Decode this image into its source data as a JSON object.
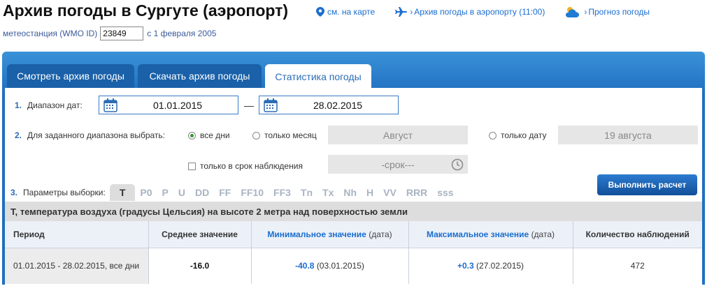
{
  "header": {
    "title": "Архив погоды в Сургуте (аэропорт)",
    "links": {
      "map": "см. на карте",
      "airport_archive": "Архив погоды в аэропорту (11:00)",
      "forecast": "Прогноз погоды"
    }
  },
  "station": {
    "label": "метеостанция (WMO ID)",
    "wmo_id": "23849",
    "since": "с 1 февраля 2005"
  },
  "tabs": [
    {
      "label": "Смотреть архив погоды",
      "active": false
    },
    {
      "label": "Скачать архив погоды",
      "active": false
    },
    {
      "label": "Статистика погоды",
      "active": true
    }
  ],
  "form": {
    "step1": {
      "num": "1.",
      "label": "Диапазон дат:",
      "date_from": "01.01.2015",
      "dash": "—",
      "date_to": "28.02.2015"
    },
    "step2": {
      "num": "2.",
      "label": "Для заданного диапазона выбрать:",
      "opt_all": "все дни",
      "opt_month": "только месяц",
      "month_value": "Август",
      "opt_date": "только дату",
      "date_value": "19 августа",
      "observation_label": "только в срок наблюдения",
      "observation_value": "-срок---"
    },
    "step3": {
      "num": "3.",
      "label": "Параметры выборки:",
      "params": [
        "T",
        "P0",
        "P",
        "U",
        "DD",
        "FF",
        "FF10",
        "FF3",
        "Tn",
        "Tx",
        "Nh",
        "H",
        "VV",
        "RRR",
        "sss"
      ],
      "selected": "T"
    },
    "calc_button": "Выполнить расчет"
  },
  "description": "T, температура воздуха (градусы Цельсия) на высоте 2 метра над поверхностью земли",
  "table": {
    "headers": {
      "period": "Период",
      "avg": "Среднее значение",
      "min_blue": "Минимальное значение",
      "min_grey": "(дата)",
      "max_blue": "Максимальное значение",
      "max_grey": "(дата)",
      "count": "Количество наблюдений"
    },
    "row": {
      "period": "01.01.2015 - 28.02.2015, все дни",
      "avg": "-16.0",
      "min_value": "-40.8",
      "min_date": "(03.01.2015)",
      "max_value": "+0.3",
      "max_date": "(27.02.2015)",
      "count": "472"
    }
  },
  "colors": {
    "accent": "#1a6dcf",
    "tab_dark": "#1a61a9",
    "panel": "#2a7fcf"
  }
}
